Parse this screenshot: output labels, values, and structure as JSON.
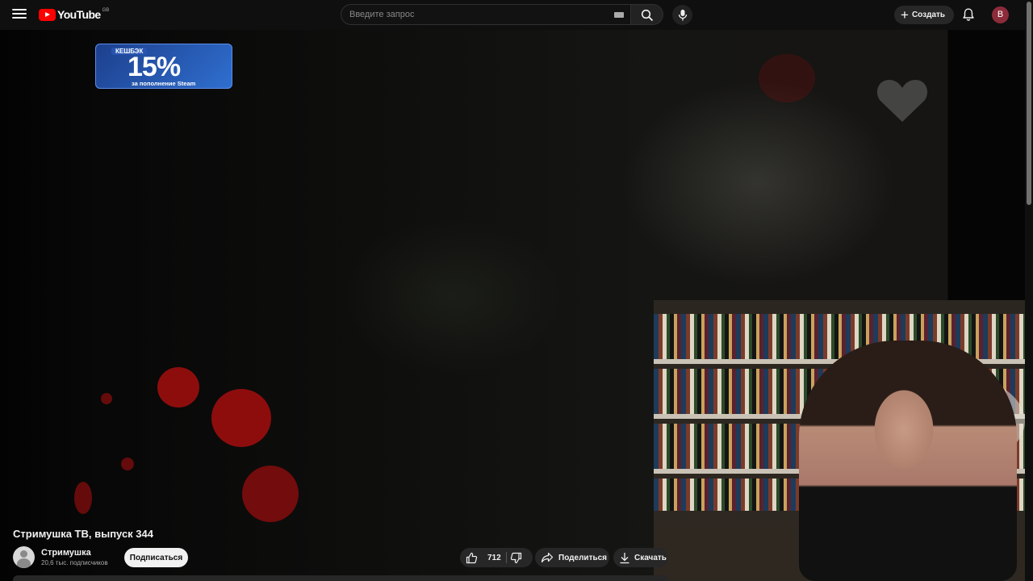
{
  "header": {
    "logo_text": "YouTube",
    "country_code": "GB",
    "search_placeholder": "Введите запрос",
    "create_label": "Создать",
    "avatar_letter": "B"
  },
  "video": {
    "title": "Стримушка ТВ, выпуск 344",
    "overlay_promo": {
      "tag": "КЕШБЭК",
      "percent": "15%",
      "subtitle": "за пополнение Steam"
    }
  },
  "channel": {
    "name": "Стримушка",
    "subscribers": "20,6 тыс. подписчиков",
    "subscribe_label": "Подписаться"
  },
  "actions": {
    "like_count": "712",
    "share_label": "Поделиться",
    "download_label": "Скачать"
  },
  "colors": {
    "background": "#0f0f0f",
    "brand_red": "#ff0000",
    "pill_bg": "#272727",
    "avatar_bg": "#8c2b3a"
  },
  "icons": [
    "menu-icon",
    "youtube-logo-icon",
    "keyboard-icon",
    "search-icon",
    "mic-icon",
    "plus-icon",
    "bell-icon",
    "like-icon",
    "dislike-icon",
    "share-icon",
    "download-icon"
  ]
}
